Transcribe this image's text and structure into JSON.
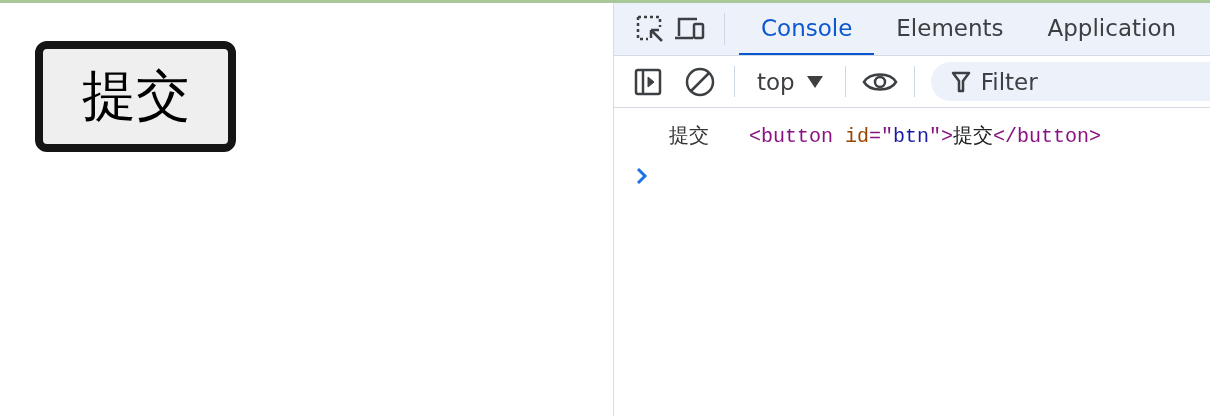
{
  "page": {
    "submit_button": "提交"
  },
  "devtools": {
    "tabs": [
      {
        "label": "Console",
        "selected": true
      },
      {
        "label": "Elements",
        "selected": false
      },
      {
        "label": "Application",
        "selected": false
      }
    ],
    "toolbar": {
      "context": "top",
      "filter_placeholder": "Filter"
    },
    "console": {
      "log_text": "提交",
      "log_element": [
        {
          "kind": "tag",
          "text": "<button"
        },
        {
          "kind": "attr",
          "text": " id"
        },
        {
          "kind": "tag",
          "text": "=\""
        },
        {
          "kind": "value",
          "text": "btn"
        },
        {
          "kind": "tag",
          "text": "\">"
        },
        {
          "kind": "text",
          "text": "提交"
        },
        {
          "kind": "tag",
          "text": "</button>"
        }
      ]
    }
  }
}
